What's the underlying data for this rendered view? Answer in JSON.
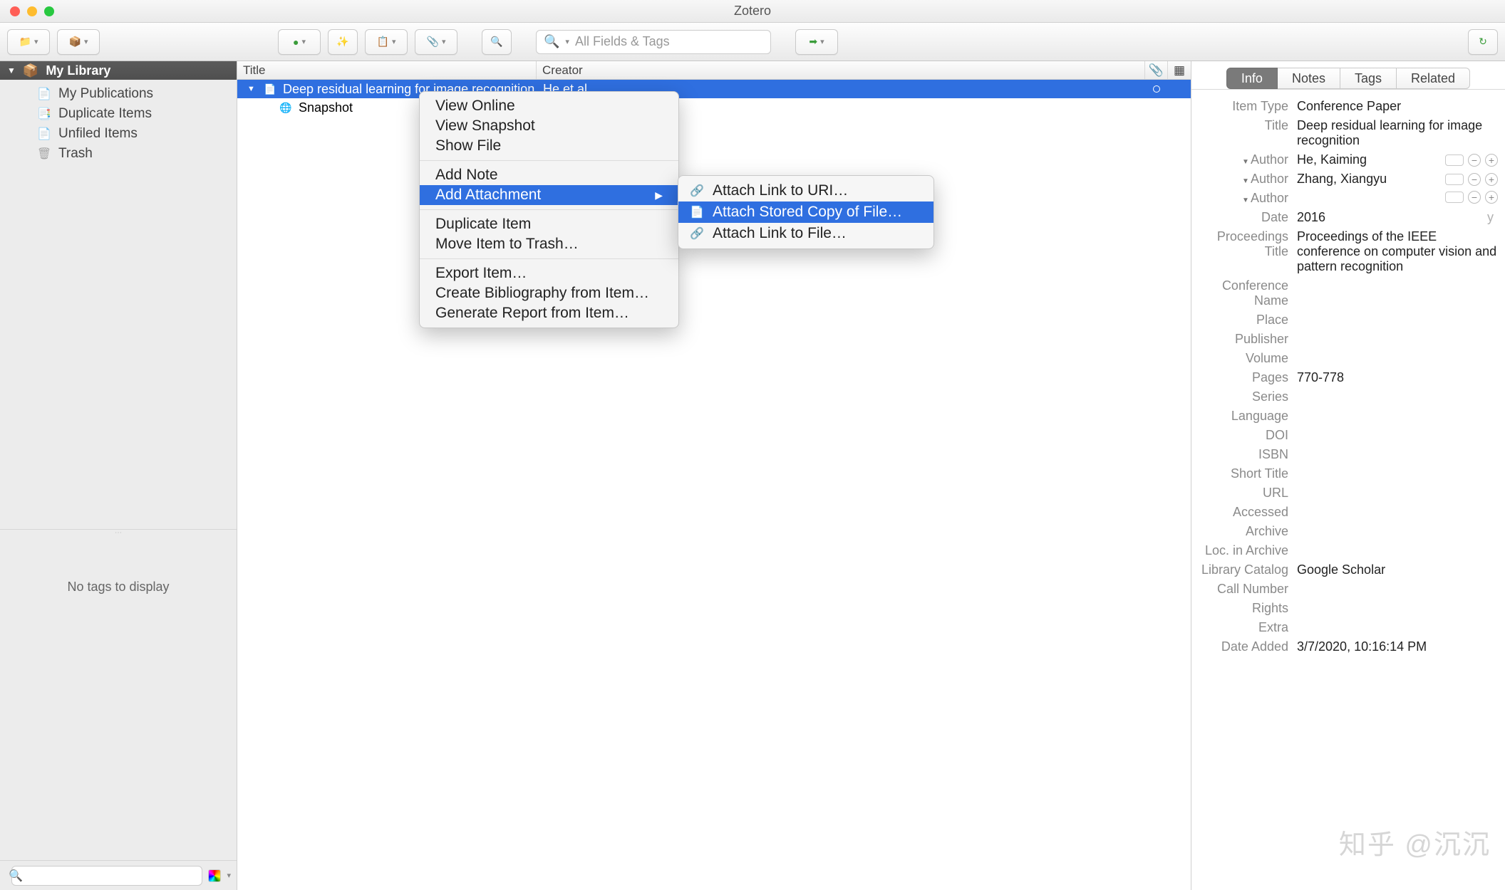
{
  "window": {
    "title": "Zotero"
  },
  "toolbar": {
    "search_placeholder": "All Fields & Tags"
  },
  "sidebar": {
    "header": "My Library",
    "items": [
      {
        "label": "My Publications"
      },
      {
        "label": "Duplicate Items"
      },
      {
        "label": "Unfiled Items"
      },
      {
        "label": "Trash"
      }
    ],
    "no_tags": "No tags to display"
  },
  "list": {
    "columns": {
      "title": "Title",
      "creator": "Creator"
    },
    "rows": [
      {
        "title": "Deep residual learning for image recognition",
        "creator": "He et al.",
        "selected": true,
        "expanded": true
      },
      {
        "title": "Snapshot",
        "child": true
      }
    ]
  },
  "context_menu": {
    "items": [
      [
        "View Online",
        "View Snapshot",
        "Show File"
      ],
      [
        "Add Note",
        {
          "label": "Add Attachment",
          "highlight": true,
          "submenu": true
        }
      ],
      [
        "Duplicate Item",
        "Move Item to Trash…"
      ],
      [
        "Export Item…",
        "Create Bibliography from Item…",
        "Generate Report from Item…"
      ]
    ]
  },
  "sub_menu": {
    "items": [
      {
        "label": "Attach Link to URI…"
      },
      {
        "label": "Attach Stored Copy of File…",
        "highlight": true
      },
      {
        "label": "Attach Link to File…"
      }
    ]
  },
  "info_tabs": [
    "Info",
    "Notes",
    "Tags",
    "Related"
  ],
  "info_active": "Info",
  "item": {
    "fields": [
      {
        "label": "Item Type",
        "value": "Conference Paper"
      },
      {
        "label": "Title",
        "value": "Deep residual learning for image recognition"
      },
      {
        "label": "Author",
        "value": "He, Kaiming",
        "tri": true,
        "ctl": true
      },
      {
        "label": "Author",
        "value": "Zhang, Xiangyu",
        "tri": true,
        "ctl": true
      },
      {
        "label": "Author",
        "value": "",
        "tri": true,
        "ctl": true
      },
      {
        "label": "Date",
        "value": "2016",
        "trail": "y"
      },
      {
        "label": "Proceedings Title",
        "value": "Proceedings of the IEEE conference on computer vision and pattern recognition"
      },
      {
        "label": "Conference Name",
        "value": ""
      },
      {
        "label": "Place",
        "value": ""
      },
      {
        "label": "Publisher",
        "value": ""
      },
      {
        "label": "Volume",
        "value": ""
      },
      {
        "label": "Pages",
        "value": "770-778"
      },
      {
        "label": "Series",
        "value": ""
      },
      {
        "label": "Language",
        "value": ""
      },
      {
        "label": "DOI",
        "value": ""
      },
      {
        "label": "ISBN",
        "value": ""
      },
      {
        "label": "Short Title",
        "value": ""
      },
      {
        "label": "URL",
        "value": ""
      },
      {
        "label": "Accessed",
        "value": ""
      },
      {
        "label": "Archive",
        "value": ""
      },
      {
        "label": "Loc. in Archive",
        "value": ""
      },
      {
        "label": "Library Catalog",
        "value": "Google Scholar"
      },
      {
        "label": "Call Number",
        "value": ""
      },
      {
        "label": "Rights",
        "value": ""
      },
      {
        "label": "Extra",
        "value": ""
      },
      {
        "label": "Date Added",
        "value": "3/7/2020, 10:16:14 PM"
      }
    ]
  },
  "watermark": "知乎 @沉沉"
}
